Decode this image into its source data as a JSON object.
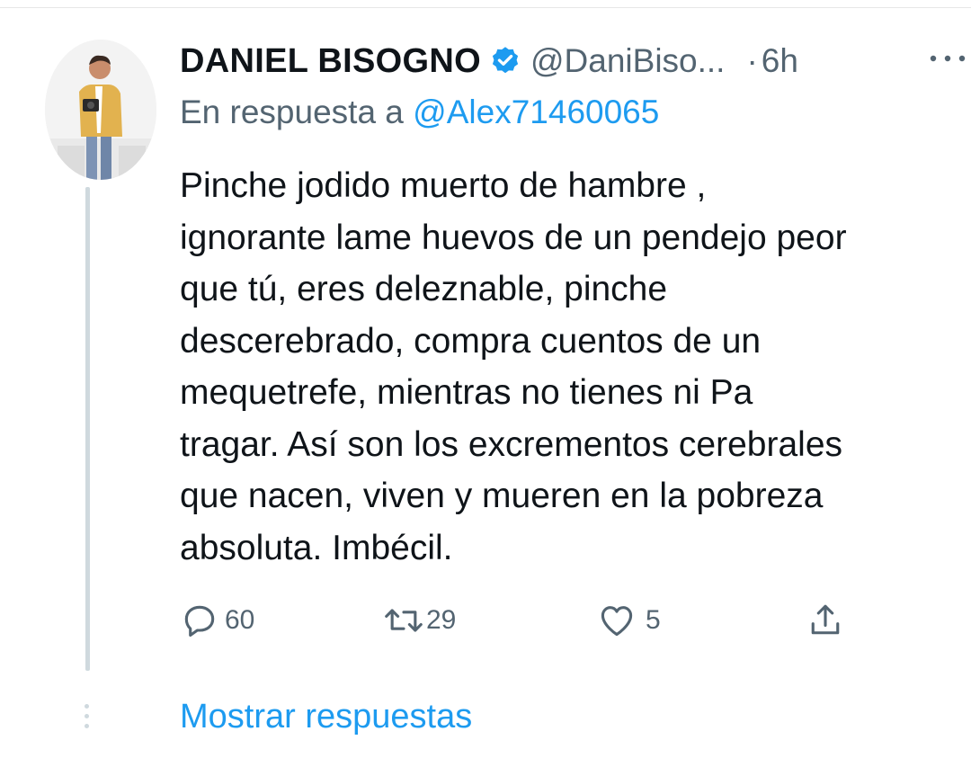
{
  "tweet": {
    "display_name": "DANIEL BISOGNO",
    "handle": "@DaniBiso...",
    "separator": "·",
    "time": "6h",
    "reply_prefix": "En respuesta a",
    "reply_mention": "@Alex71460065",
    "text_lines": [
      "Pinche jodido muerto de hambre ,",
      "ignorante lame huevos de un pendejo peor",
      "que tú, eres deleznable, pinche",
      "descerebrado, compra cuentos de un",
      "mequetrefe, mientras no tienes ni Pa",
      "tragar. Así son los excrementos cerebrales",
      "que nacen, viven y mueren en la pobreza",
      "absoluta. Imbécil."
    ],
    "actions": {
      "reply_count": "60",
      "retweet_count": "29",
      "like_count": "5"
    },
    "show_replies": "Mostrar respuestas"
  },
  "icons": {
    "verified": "verified-badge-icon",
    "more": "more-horizontal-icon",
    "reply": "reply-bubble-icon",
    "retweet": "retweet-icon",
    "like": "heart-icon",
    "share": "share-icon"
  },
  "colors": {
    "accent": "#1d9bf0",
    "text_primary": "#0f1419",
    "text_secondary": "#536471",
    "thread_line": "#cfd9de"
  }
}
